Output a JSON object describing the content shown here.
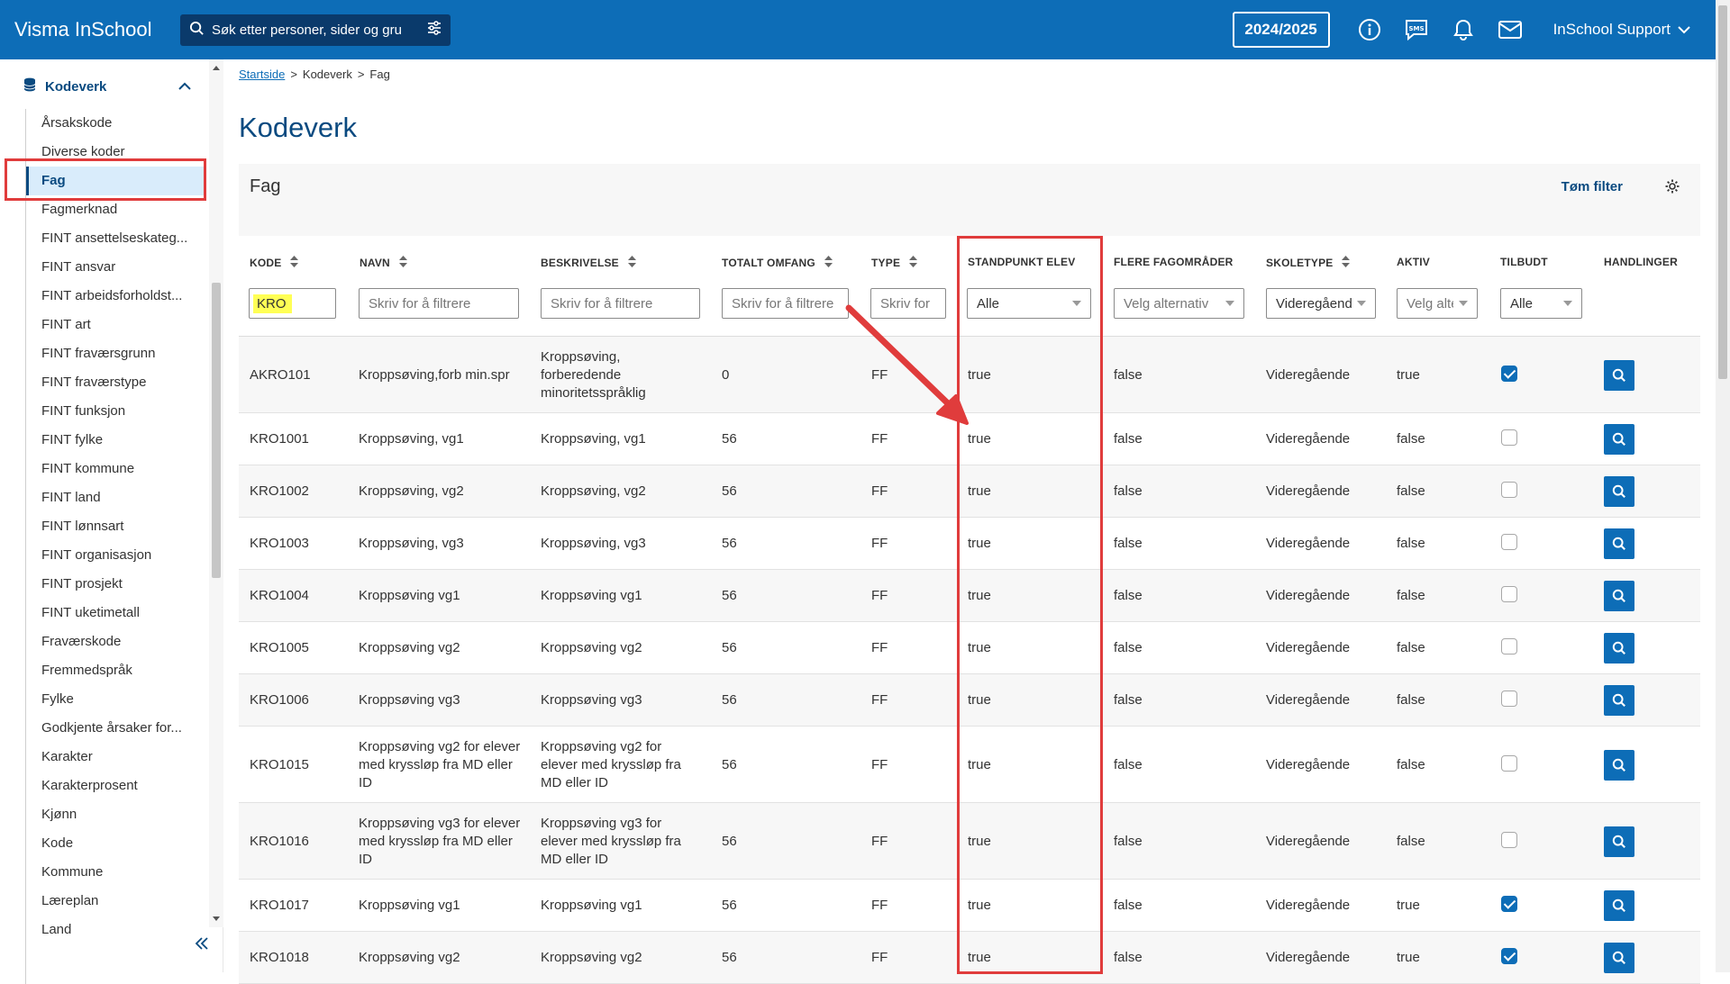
{
  "topbar": {
    "brand": "Visma InSchool",
    "search_placeholder": "Søk etter personer, sider og gru",
    "year": "2024/2025",
    "user": "InSchool Support"
  },
  "sidebar": {
    "section_title": "Kodeverk",
    "items": [
      {
        "label": "Årsakskode",
        "active": false
      },
      {
        "label": "Diverse koder",
        "active": false
      },
      {
        "label": "Fag",
        "active": true
      },
      {
        "label": "Fagmerknad",
        "active": false
      },
      {
        "label": "FINT ansettelseskateg...",
        "active": false
      },
      {
        "label": "FINT ansvar",
        "active": false
      },
      {
        "label": "FINT arbeidsforholdst...",
        "active": false
      },
      {
        "label": "FINT art",
        "active": false
      },
      {
        "label": "FINT fraværsgrunn",
        "active": false
      },
      {
        "label": "FINT fraværstype",
        "active": false
      },
      {
        "label": "FINT funksjon",
        "active": false
      },
      {
        "label": "FINT fylke",
        "active": false
      },
      {
        "label": "FINT kommune",
        "active": false
      },
      {
        "label": "FINT land",
        "active": false
      },
      {
        "label": "FINT lønnsart",
        "active": false
      },
      {
        "label": "FINT organisasjon",
        "active": false
      },
      {
        "label": "FINT prosjekt",
        "active": false
      },
      {
        "label": "FINT uketimetall",
        "active": false
      },
      {
        "label": "Fraværskode",
        "active": false
      },
      {
        "label": "Fremmedspråk",
        "active": false
      },
      {
        "label": "Fylke",
        "active": false
      },
      {
        "label": "Godkjente årsaker for...",
        "active": false
      },
      {
        "label": "Karakter",
        "active": false
      },
      {
        "label": "Karakterprosent",
        "active": false
      },
      {
        "label": "Kjønn",
        "active": false
      },
      {
        "label": "Kode",
        "active": false
      },
      {
        "label": "Kommune",
        "active": false
      },
      {
        "label": "Læreplan",
        "active": false
      },
      {
        "label": "Land",
        "active": false
      }
    ]
  },
  "breadcrumb": {
    "home": "Startside",
    "level1": "Kodeverk",
    "current": "Fag",
    "sep": ">"
  },
  "page": {
    "title": "Kodeverk",
    "panel_title": "Fag",
    "clear_filter": "Tøm filter"
  },
  "table": {
    "headers": {
      "kode": "KODE",
      "navn": "NAVN",
      "beskrivelse": "BESKRIVELSE",
      "omfang": "TOTALT OMFANG",
      "type": "TYPE",
      "standpunkt": "STANDPUNKT ELEV",
      "flere": "FLERE FAGOMRÅDER",
      "skoletype": "SKOLETYPE",
      "aktiv": "AKTIV",
      "tilbudt": "TILBUDT",
      "handlinger": "HANDLINGER"
    },
    "filters": {
      "kode": "KRO",
      "navn_placeholder": "Skriv for å filtrere",
      "beskrivelse_placeholder": "Skriv for å filtrere",
      "omfang_placeholder": "Skriv for å filtrere",
      "type_placeholder": "Skriv for",
      "standpunkt": "Alle",
      "flere": "Velg alternativ",
      "skoletype": "Videregående",
      "aktiv": "Velg alternativ",
      "tilbudt": "Alle"
    },
    "rows": [
      {
        "kode": "AKRO101",
        "navn": "Kroppsøving,forb min.spr",
        "beskrivelse": "Kroppsøving, forberedende minoritetsspråklig",
        "omfang": "0",
        "type": "FF",
        "standpunkt": "true",
        "flere": "false",
        "skoletype": "Videregående",
        "aktiv": "true",
        "tilbudt": true
      },
      {
        "kode": "KRO1001",
        "navn": "Kroppsøving, vg1",
        "beskrivelse": "Kroppsøving, vg1",
        "omfang": "56",
        "type": "FF",
        "standpunkt": "true",
        "flere": "false",
        "skoletype": "Videregående",
        "aktiv": "false",
        "tilbudt": false
      },
      {
        "kode": "KRO1002",
        "navn": "Kroppsøving, vg2",
        "beskrivelse": "Kroppsøving, vg2",
        "omfang": "56",
        "type": "FF",
        "standpunkt": "true",
        "flere": "false",
        "skoletype": "Videregående",
        "aktiv": "false",
        "tilbudt": false
      },
      {
        "kode": "KRO1003",
        "navn": "Kroppsøving, vg3",
        "beskrivelse": "Kroppsøving, vg3",
        "omfang": "56",
        "type": "FF",
        "standpunkt": "true",
        "flere": "false",
        "skoletype": "Videregående",
        "aktiv": "false",
        "tilbudt": false
      },
      {
        "kode": "KRO1004",
        "navn": "Kroppsøving vg1",
        "beskrivelse": "Kroppsøving vg1",
        "omfang": "56",
        "type": "FF",
        "standpunkt": "true",
        "flere": "false",
        "skoletype": "Videregående",
        "aktiv": "false",
        "tilbudt": false
      },
      {
        "kode": "KRO1005",
        "navn": "Kroppsøving vg2",
        "beskrivelse": "Kroppsøving vg2",
        "omfang": "56",
        "type": "FF",
        "standpunkt": "true",
        "flere": "false",
        "skoletype": "Videregående",
        "aktiv": "false",
        "tilbudt": false
      },
      {
        "kode": "KRO1006",
        "navn": "Kroppsøving vg3",
        "beskrivelse": "Kroppsøving vg3",
        "omfang": "56",
        "type": "FF",
        "standpunkt": "true",
        "flere": "false",
        "skoletype": "Videregående",
        "aktiv": "false",
        "tilbudt": false
      },
      {
        "kode": "KRO1015",
        "navn": "Kroppsøving vg2 for elever med kryssløp fra MD eller ID",
        "beskrivelse": "Kroppsøving vg2 for elever med kryssløp fra MD eller ID",
        "omfang": "56",
        "type": "FF",
        "standpunkt": "true",
        "flere": "false",
        "skoletype": "Videregående",
        "aktiv": "false",
        "tilbudt": false
      },
      {
        "kode": "KRO1016",
        "navn": "Kroppsøving vg3 for elever med kryssløp fra MD eller ID",
        "beskrivelse": "Kroppsøving vg3 for elever med kryssløp fra MD eller ID",
        "omfang": "56",
        "type": "FF",
        "standpunkt": "true",
        "flere": "false",
        "skoletype": "Videregående",
        "aktiv": "false",
        "tilbudt": false
      },
      {
        "kode": "KRO1017",
        "navn": "Kroppsøving vg1",
        "beskrivelse": "Kroppsøving vg1",
        "omfang": "56",
        "type": "FF",
        "standpunkt": "true",
        "flere": "false",
        "skoletype": "Videregående",
        "aktiv": "true",
        "tilbudt": true
      },
      {
        "kode": "KRO1018",
        "navn": "Kroppsøving vg2",
        "beskrivelse": "Kroppsøving vg2",
        "omfang": "56",
        "type": "FF",
        "standpunkt": "true",
        "flere": "false",
        "skoletype": "Videregående",
        "aktiv": "true",
        "tilbudt": true
      }
    ]
  },
  "colors": {
    "brand": "#0d6db7",
    "navy": "#0a4a80",
    "annotation": "#e03c3c",
    "highlight": "#ffff55"
  }
}
